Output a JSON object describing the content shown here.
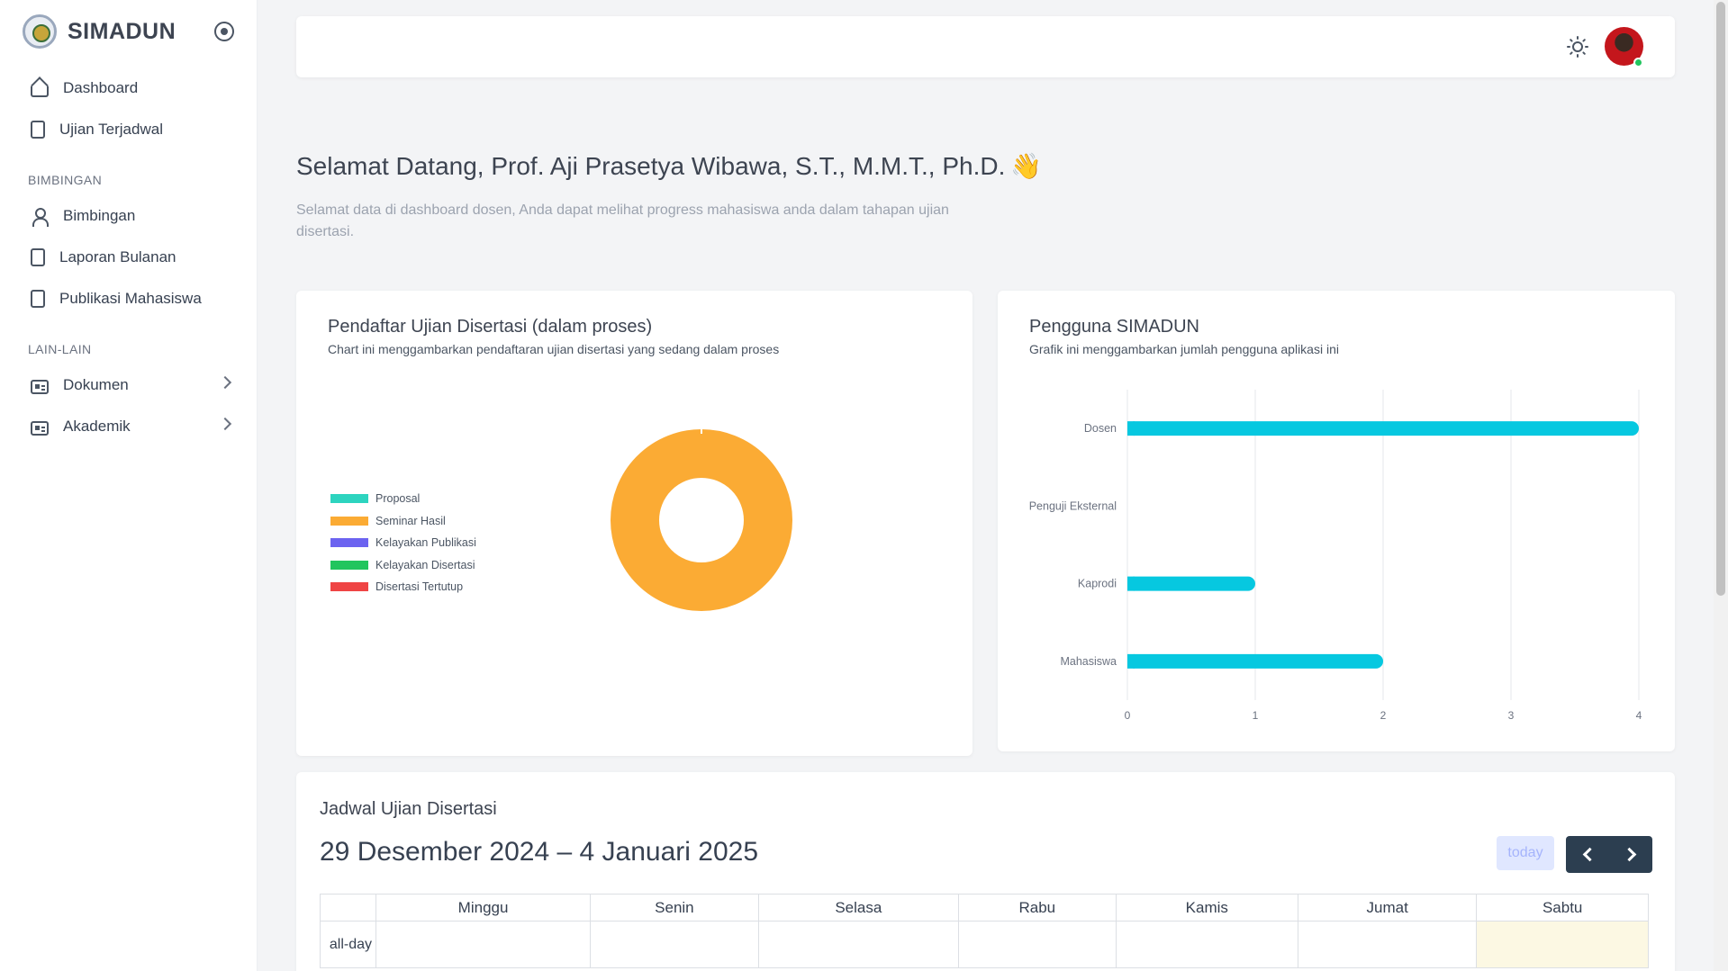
{
  "app": {
    "name": "SIMADUN"
  },
  "sidebar": {
    "items_top": [
      {
        "label": "Dashboard",
        "icon": "home-icon"
      },
      {
        "label": "Ujian Terjadwal",
        "icon": "document-icon"
      }
    ],
    "section_bimbingan": "BIMBINGAN",
    "items_bimbingan": [
      {
        "label": "Bimbingan",
        "icon": "user-icon"
      },
      {
        "label": "Laporan Bulanan",
        "icon": "clipboard-clock-icon"
      },
      {
        "label": "Publikasi Mahasiswa",
        "icon": "file-icon"
      }
    ],
    "section_lain": "LAIN-LAIN",
    "items_lain": [
      {
        "label": "Dokumen",
        "icon": "id-card-icon"
      },
      {
        "label": "Akademik",
        "icon": "id-card-icon"
      }
    ]
  },
  "welcome": {
    "title": "Selamat Datang, Prof. Aji Prasetya Wibawa, S.T., M.M.T., Ph.D.",
    "emoji": "👋",
    "subtitle": "Selamat data di dashboard dosen, Anda dapat melihat progress mahasiswa anda dalam tahapan ujian disertasi."
  },
  "donut_card": {
    "title": "Pendaftar Ujian Disertasi (dalam proses)",
    "subtitle": "Chart ini menggambarkan pendaftaran ujian disertasi yang sedang dalam proses"
  },
  "bar_card": {
    "title": "Pengguna SIMADUN",
    "subtitle": "Grafik ini menggambarkan jumlah pengguna aplikasi ini"
  },
  "chart_data": [
    {
      "type": "pie",
      "variant": "donut",
      "categories": [
        "Proposal",
        "Seminar Hasil",
        "Kelayakan Publikasi",
        "Kelayakan Disertasi",
        "Disertasi Tertutup"
      ],
      "values": [
        0,
        1,
        0,
        0,
        0
      ],
      "colors": [
        "#2dd4bf",
        "#fbab34",
        "#6c63f0",
        "#22c55e",
        "#ef4444"
      ],
      "legend": "left"
    },
    {
      "type": "bar",
      "orientation": "horizontal",
      "categories": [
        "Dosen",
        "Penguji Eksternal",
        "Kaprodi",
        "Mahasiswa"
      ],
      "values": [
        4,
        0,
        1,
        2
      ],
      "xlim": [
        0,
        4
      ],
      "xticks": [
        "0",
        "1",
        "2",
        "3",
        "4"
      ],
      "grid": true,
      "color": "#06c8e0"
    }
  ],
  "calendar": {
    "title": "Jadwal Ujian Disertasi",
    "range": "29 Desember 2024 – 4 Januari 2025",
    "today_label": "today",
    "days": [
      "Minggu",
      "Senin",
      "Selasa",
      "Rabu",
      "Kamis",
      "Jumat",
      "Sabtu"
    ],
    "allday_label": "all-day"
  }
}
